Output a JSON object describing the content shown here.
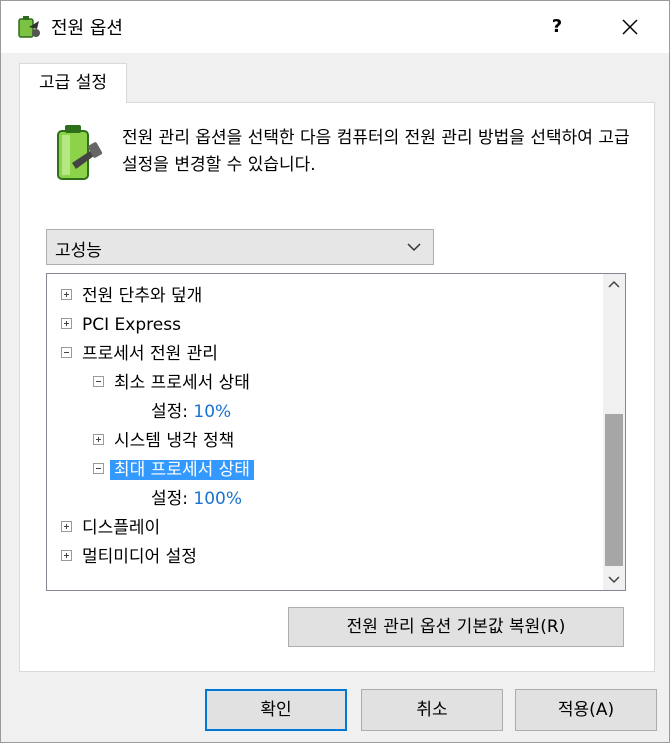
{
  "window": {
    "title": "전원 옵션",
    "help": "?",
    "close": "✕"
  },
  "tab": {
    "label": "고급 설정"
  },
  "description": "전원 관리 옵션을 선택한 다음 컴퓨터의 전원 관리 방법을 선택하여 고급 설정을 변경할 수 있습니다.",
  "plan": {
    "selected": "고성능"
  },
  "tree": {
    "items": [
      {
        "label": "전원 단추와 덮개"
      },
      {
        "label": "PCI Express"
      },
      {
        "label": "프로세서 전원 관리"
      },
      {
        "label": "최소 프로세서 상태"
      },
      {
        "setting_label": "설정:",
        "value": "10%"
      },
      {
        "label": "시스템 냉각 정책"
      },
      {
        "label": "최대 프로세서 상태"
      },
      {
        "setting_label": "설정:",
        "value": "100%"
      },
      {
        "label": "디스플레이"
      },
      {
        "label": "멀티미디어 설정"
      }
    ]
  },
  "buttons": {
    "restore": "전원 관리 옵션 기본값 복원(R)",
    "ok": "확인",
    "cancel": "취소",
    "apply": "적용(A)"
  },
  "colors": {
    "selection": "#3399ff",
    "value_text": "#1874d2",
    "default_border": "#0078d7"
  }
}
